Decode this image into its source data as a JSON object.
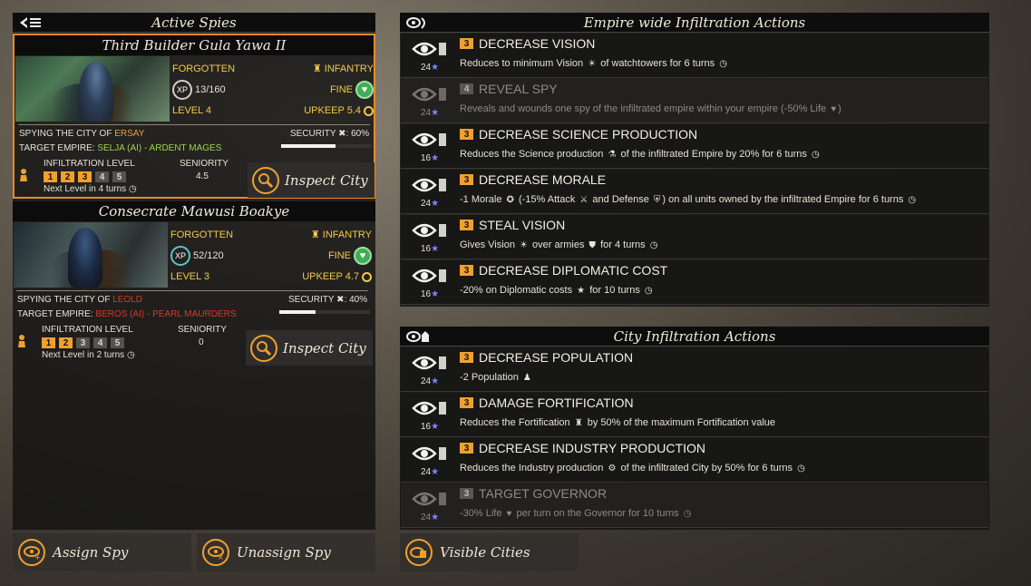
{
  "left": {
    "title": "Active Spies",
    "spies": [
      {
        "name": "Third Builder Gula Yawa II",
        "faction": "FORGOTTEN",
        "unit_type": "INFANTRY",
        "xp_label": "XP",
        "xp": "13/160",
        "status": "FINE",
        "level": "LEVEL 4",
        "upkeep": "UPKEEP 5.4",
        "spying_label": "SPYING THE CITY OF",
        "city": "ERSAY",
        "target_label": "TARGET EMPIRE:",
        "target": "SELJA (AI) - ARDENT MAGES",
        "security_label": "SECURITY",
        "security_value": "60%",
        "security_fraction": 0.6,
        "infil_label": "INFILTRATION LEVEL",
        "infil_levels": [
          "1",
          "2",
          "3",
          "4",
          "5"
        ],
        "infil_active": 3,
        "seniority_label": "SENIORITY",
        "seniority": "4.5",
        "next_level": "Next Level in 4 turns",
        "inspect_label": "Inspect City"
      },
      {
        "name": "Consecrate Mawusi Boakye",
        "faction": "FORGOTTEN",
        "unit_type": "INFANTRY",
        "xp_label": "XP",
        "xp": "52/120",
        "status": "FINE",
        "level": "LEVEL 3",
        "upkeep": "UPKEEP 4.7",
        "spying_label": "SPYING THE CITY OF",
        "city": "LEOLD",
        "target_label": "TARGET EMPIRE:",
        "target": "BEROS (AI) - PEARL MAURDERS",
        "security_label": "SECURITY",
        "security_value": "40%",
        "security_fraction": 0.4,
        "infil_label": "INFILTRATION LEVEL",
        "infil_levels": [
          "1",
          "2",
          "3",
          "4",
          "5"
        ],
        "infil_active": 2,
        "seniority_label": "SENIORITY",
        "seniority": "0",
        "next_level": "Next Level in 2 turns",
        "inspect_label": "Inspect City"
      }
    ],
    "assign_label": "Assign Spy",
    "unassign_label": "Unassign Spy"
  },
  "empire": {
    "title": "Empire wide Infiltration Actions",
    "actions": [
      {
        "level": "3",
        "title": "DECREASE VISION",
        "cost": "24",
        "desc": [
          "Reduces to minimum Vision ",
          "☀",
          " of watchtowers for 6 turns ",
          "◷"
        ],
        "disabled": false,
        "icon": "eye-vision-icon"
      },
      {
        "level": "4",
        "title": "REVEAL SPY",
        "cost": "24",
        "desc": [
          "Reveals and wounds one spy of the infiltrated empire within your empire (-50% Life ",
          "♥",
          ")"
        ],
        "disabled": true,
        "icon": "eye-reveal-icon"
      },
      {
        "level": "3",
        "title": "DECREASE SCIENCE PRODUCTION",
        "cost": "16",
        "desc": [
          "Reduces the Science production ",
          "⚗",
          " of the infiltrated Empire by 20% for 6 turns ",
          "◷"
        ],
        "disabled": false,
        "icon": "eye-science-icon"
      },
      {
        "level": "3",
        "title": "DECREASE MORALE",
        "cost": "24",
        "desc": [
          "-1 Morale ",
          "✪",
          " (-15% Attack ",
          "⚔",
          " and Defense ",
          "⛨",
          ") on all units owned by the infiltrated Empire for 6 turns ",
          "◷"
        ],
        "disabled": false,
        "icon": "eye-morale-icon"
      },
      {
        "level": "3",
        "title": "STEAL VISION",
        "cost": "16",
        "desc": [
          "Gives Vision ",
          "☀",
          " over armies ",
          "⛊",
          " for 4 turns ",
          "◷"
        ],
        "disabled": false,
        "icon": "eye-steal-icon"
      },
      {
        "level": "3",
        "title": "DECREASE DIPLOMATIC COST",
        "cost": "16",
        "desc": [
          "-20% on Diplomatic costs ",
          "★",
          " for 10 turns ",
          "◷"
        ],
        "disabled": false,
        "icon": "eye-diplomatic-icon"
      }
    ]
  },
  "city": {
    "title": "City Infiltration Actions",
    "actions": [
      {
        "level": "3",
        "title": "DECREASE POPULATION",
        "cost": "24",
        "desc": [
          "-2 Population ",
          "♟"
        ],
        "disabled": false,
        "icon": "eye-population-icon"
      },
      {
        "level": "3",
        "title": "DAMAGE FORTIFICATION",
        "cost": "16",
        "desc": [
          "Reduces the Fortification ",
          "♜",
          " by 50% of the maximum Fortification value"
        ],
        "disabled": false,
        "icon": "eye-fortification-icon"
      },
      {
        "level": "3",
        "title": "DECREASE INDUSTRY PRODUCTION",
        "cost": "24",
        "desc": [
          "Reduces the Industry production ",
          "⚙",
          " of the infiltrated City by 50% for 6 turns ",
          "◷"
        ],
        "disabled": false,
        "icon": "eye-industry-icon"
      },
      {
        "level": "3",
        "title": "TARGET GOVERNOR",
        "cost": "24",
        "desc": [
          "-30% Life ",
          "♥",
          " per turn on the Governor for 10 turns ",
          "◷"
        ],
        "disabled": true,
        "icon": "eye-governor-icon"
      }
    ]
  },
  "visible_cities_label": "Visible Cities",
  "colors": {
    "accent": "#f0a030",
    "highlight_border": "#e8892a",
    "green": "#9ed14a",
    "red": "#d43a2a",
    "star": "#7b86ff"
  }
}
